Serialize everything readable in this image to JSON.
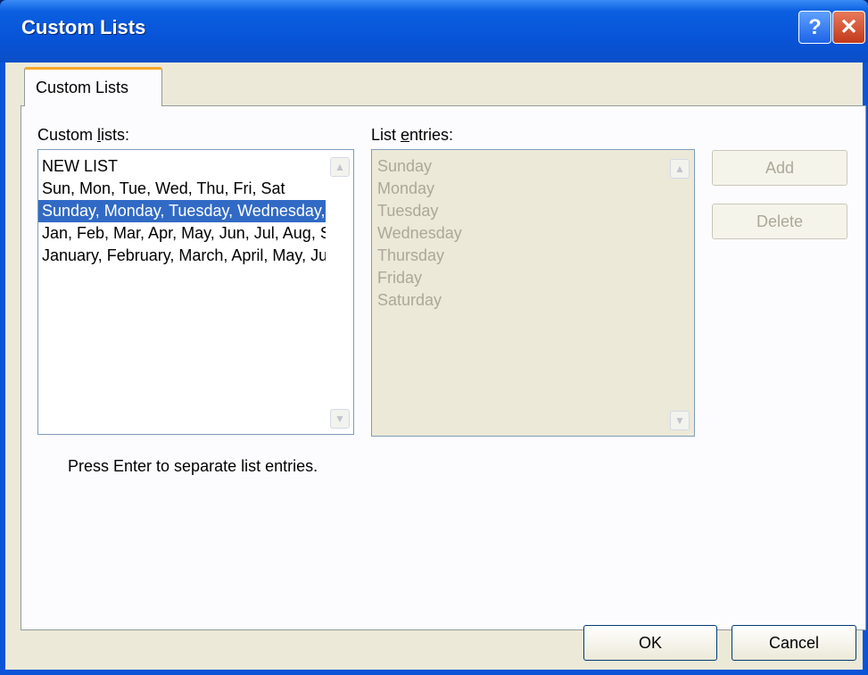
{
  "window": {
    "title": "Custom Lists",
    "help_glyph": "?",
    "close_glyph": "✕"
  },
  "tab": {
    "label": "Custom Lists"
  },
  "custom_lists": {
    "label_pre": "Custom ",
    "label_accel": "l",
    "label_post": "ists:",
    "items": [
      "NEW LIST",
      "Sun, Mon, Tue, Wed, Thu, Fri, Sat",
      "Sunday, Monday, Tuesday, Wednesday, Thursday, Friday, Saturday",
      "Jan, Feb, Mar, Apr, May, Jun, Jul, Aug, Sep, Oct, Nov, Dec",
      "January, February, March, April, May, June, July, August, September, October, November, December"
    ],
    "selected_index": 2
  },
  "list_entries": {
    "label_pre": "List ",
    "label_accel": "e",
    "label_post": "ntries:",
    "items": [
      "Sunday",
      "Monday",
      "Tuesday",
      "Wednesday",
      "Thursday",
      "Friday",
      "Saturday"
    ]
  },
  "buttons": {
    "add": "Add",
    "delete": "Delete",
    "ok": "OK",
    "cancel": "Cancel"
  },
  "hint": "Press Enter to separate list entries.",
  "scroll": {
    "up_glyph": "▲",
    "down_glyph": "▼"
  },
  "colors": {
    "selection": "#316ac5",
    "titlebar": "#0854d8",
    "disabled_text": "#aca899"
  }
}
